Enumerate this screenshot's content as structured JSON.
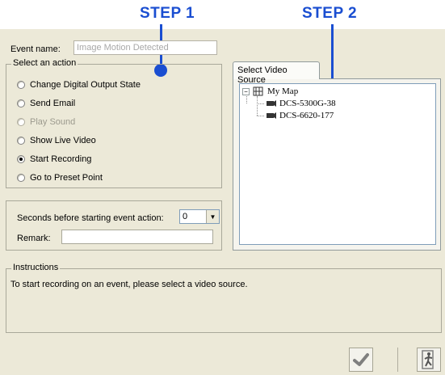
{
  "annotations": {
    "step1": "STEP 1",
    "step2": "STEP 2"
  },
  "event": {
    "name_label": "Event name:",
    "name_value": "Image Motion Detected"
  },
  "action_group": {
    "legend": "Select an action",
    "options": [
      {
        "label": "Change Digital Output State",
        "checked": false,
        "enabled": true
      },
      {
        "label": "Send Email",
        "checked": false,
        "enabled": true
      },
      {
        "label": "Play Sound",
        "checked": false,
        "enabled": false
      },
      {
        "label": "Show Live Video",
        "checked": false,
        "enabled": true
      },
      {
        "label": "Start Recording",
        "checked": true,
        "enabled": true
      },
      {
        "label": "Go to Preset Point",
        "checked": false,
        "enabled": true
      }
    ]
  },
  "timing": {
    "seconds_label": "Seconds before starting event action:",
    "seconds_value": "0",
    "remark_label": "Remark:",
    "remark_value": ""
  },
  "video_source": {
    "tab_label": "Select Video Source",
    "tree": {
      "root": "My Map",
      "children": [
        "DCS-5300G-38",
        "DCS-6620-177"
      ]
    }
  },
  "instructions": {
    "legend": "Instructions",
    "text": "To start recording on an event, please select a video source."
  },
  "footer": {
    "ok_icon": "checkmark-icon",
    "exit_icon": "exit-running-person-icon"
  },
  "colors": {
    "annotation_blue": "#1a4ed1",
    "dialog_bg": "#ece9d8"
  }
}
